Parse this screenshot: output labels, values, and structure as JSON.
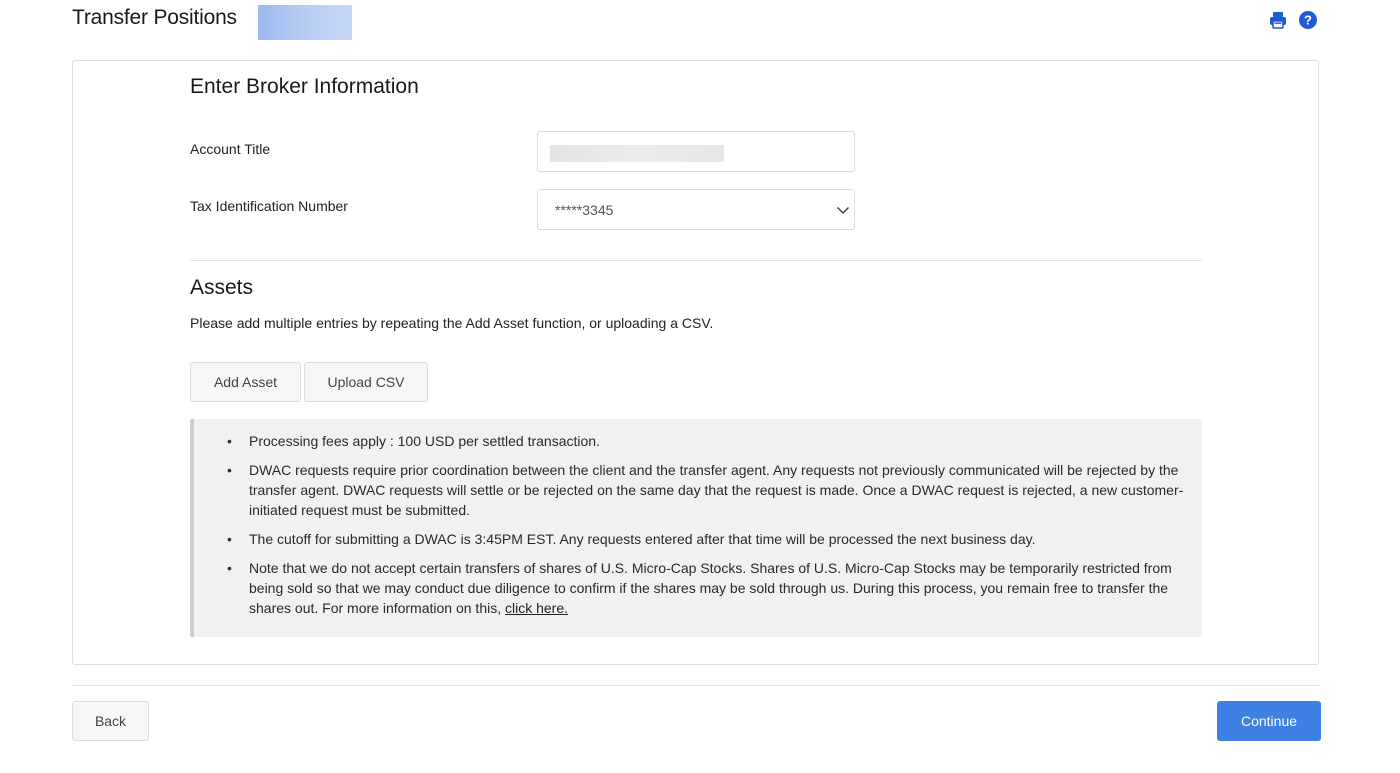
{
  "page": {
    "title": "Transfer Positions"
  },
  "icons": {
    "print": "print-icon",
    "help": "help-icon"
  },
  "broker_section": {
    "heading": "Enter Broker Information",
    "account_title_label": "Account Title",
    "tax_id_label": "Tax Identification Number",
    "tax_id_value": "*****3345"
  },
  "assets_section": {
    "heading": "Assets",
    "description": "Please add multiple entries by repeating the Add Asset function, or uploading a CSV.",
    "add_asset_label": "Add Asset",
    "upload_csv_label": "Upload CSV"
  },
  "notices": [
    "Processing fees apply : 100 USD per settled transaction.",
    "DWAC requests require prior coordination between the client and the transfer agent. Any requests not previously communicated will be rejected by the transfer agent. DWAC requests will settle or be rejected on the same day that the request is made. Once a DWAC request is rejected, a new customer-initiated request must be submitted.",
    "The cutoff for submitting a DWAC is 3:45PM EST. Any requests entered after that time will be processed the next business day.",
    "Note that we do not accept certain transfers of shares of U.S. Micro-Cap Stocks. Shares of U.S. Micro-Cap Stocks may be temporarily restricted from being sold so that we may conduct due diligence to confirm if the shares may be sold through us. During this process, you remain free to transfer the shares out. For more information on this,"
  ],
  "notice_link": "click here.",
  "footer": {
    "back_label": "Back",
    "continue_label": "Continue"
  },
  "colors": {
    "primary": "#3f80e4",
    "icon_blue": "#1f5bd6"
  }
}
